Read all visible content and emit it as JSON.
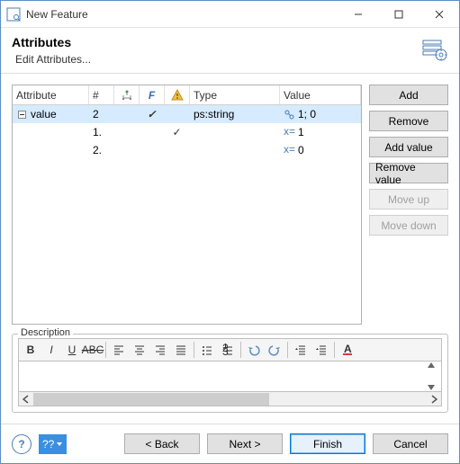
{
  "window": {
    "title": "New Feature"
  },
  "header": {
    "title": "Attributes",
    "subtitle": "Edit Attributes..."
  },
  "columns": {
    "attribute": "Attribute",
    "num": "#",
    "f": "F",
    "type": "Type",
    "value": "Value"
  },
  "rows": [
    {
      "attr": "value",
      "num": "2",
      "h": "",
      "f": "✓",
      "warn": "",
      "type": "ps:string",
      "val": "1; 0",
      "selected": true,
      "indent": 0,
      "expander": true
    },
    {
      "attr": "",
      "num": "1.",
      "h": "",
      "f": "",
      "warn": "✓",
      "type": "",
      "val": "1",
      "selected": false,
      "indent": 1,
      "expander": false
    },
    {
      "attr": "",
      "num": "2.",
      "h": "",
      "f": "",
      "warn": "",
      "type": "",
      "val": "0",
      "selected": false,
      "indent": 1,
      "expander": false
    }
  ],
  "side_buttons": {
    "add": "Add",
    "remove": "Remove",
    "add_value": "Add value",
    "remove_value": "Remove value",
    "move_up": "Move up",
    "move_down": "Move down"
  },
  "desc": {
    "legend": "Description"
  },
  "footer": {
    "back": "< Back",
    "next": "Next >",
    "finish": "Finish",
    "cancel": "Cancel",
    "help": "?",
    "wiz": "??"
  }
}
